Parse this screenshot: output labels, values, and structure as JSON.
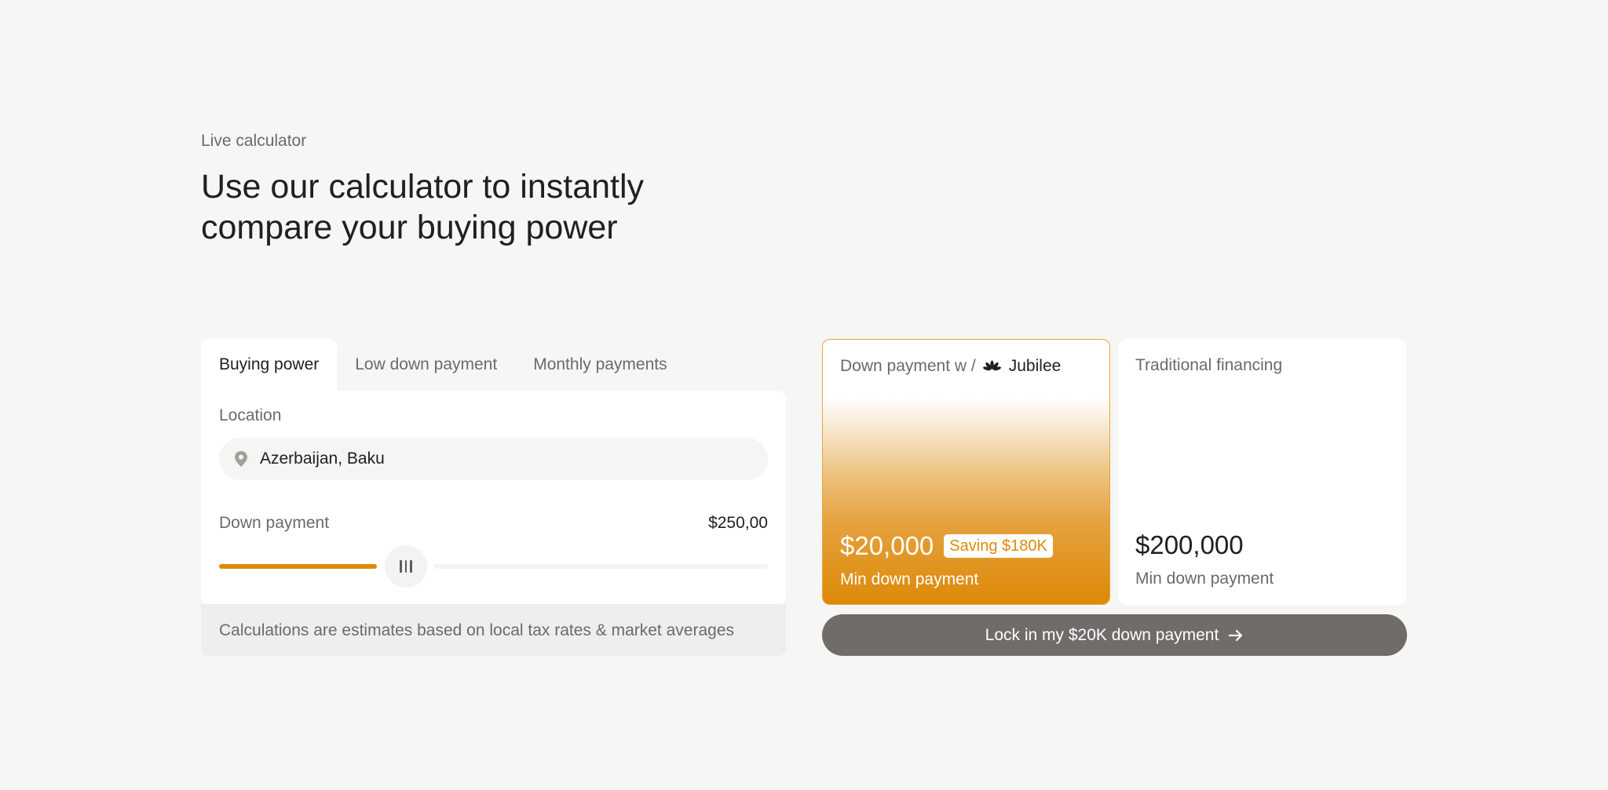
{
  "header": {
    "eyebrow": "Live calculator",
    "title": "Use our calculator to instantly compare your buying power"
  },
  "tabs": [
    {
      "label": "Buying power",
      "active": true
    },
    {
      "label": "Low down payment",
      "active": false
    },
    {
      "label": "Monthly payments",
      "active": false
    }
  ],
  "calculator": {
    "location_label": "Location",
    "location_value": "Azerbaijan, Baku",
    "down_payment_label": "Down payment",
    "down_payment_value": "$250,00",
    "slider_level": 0.3,
    "disclaimer": "Calculations are estimates based on local tax rates & market averages"
  },
  "comparison": {
    "jubilee": {
      "title_prefix": "Down payment w /",
      "brand": "Jubilee",
      "amount": "$20,000",
      "saving_badge": "Saving $180K",
      "subtitle": "Min down payment"
    },
    "traditional": {
      "title": "Traditional financing",
      "amount": "$200,000",
      "subtitle": "Min down payment"
    }
  },
  "cta": {
    "label": "Lock in my $20K down payment"
  },
  "colors": {
    "accent": "#de8a07",
    "background": "#f6f6f4",
    "cta": "#706c69"
  }
}
